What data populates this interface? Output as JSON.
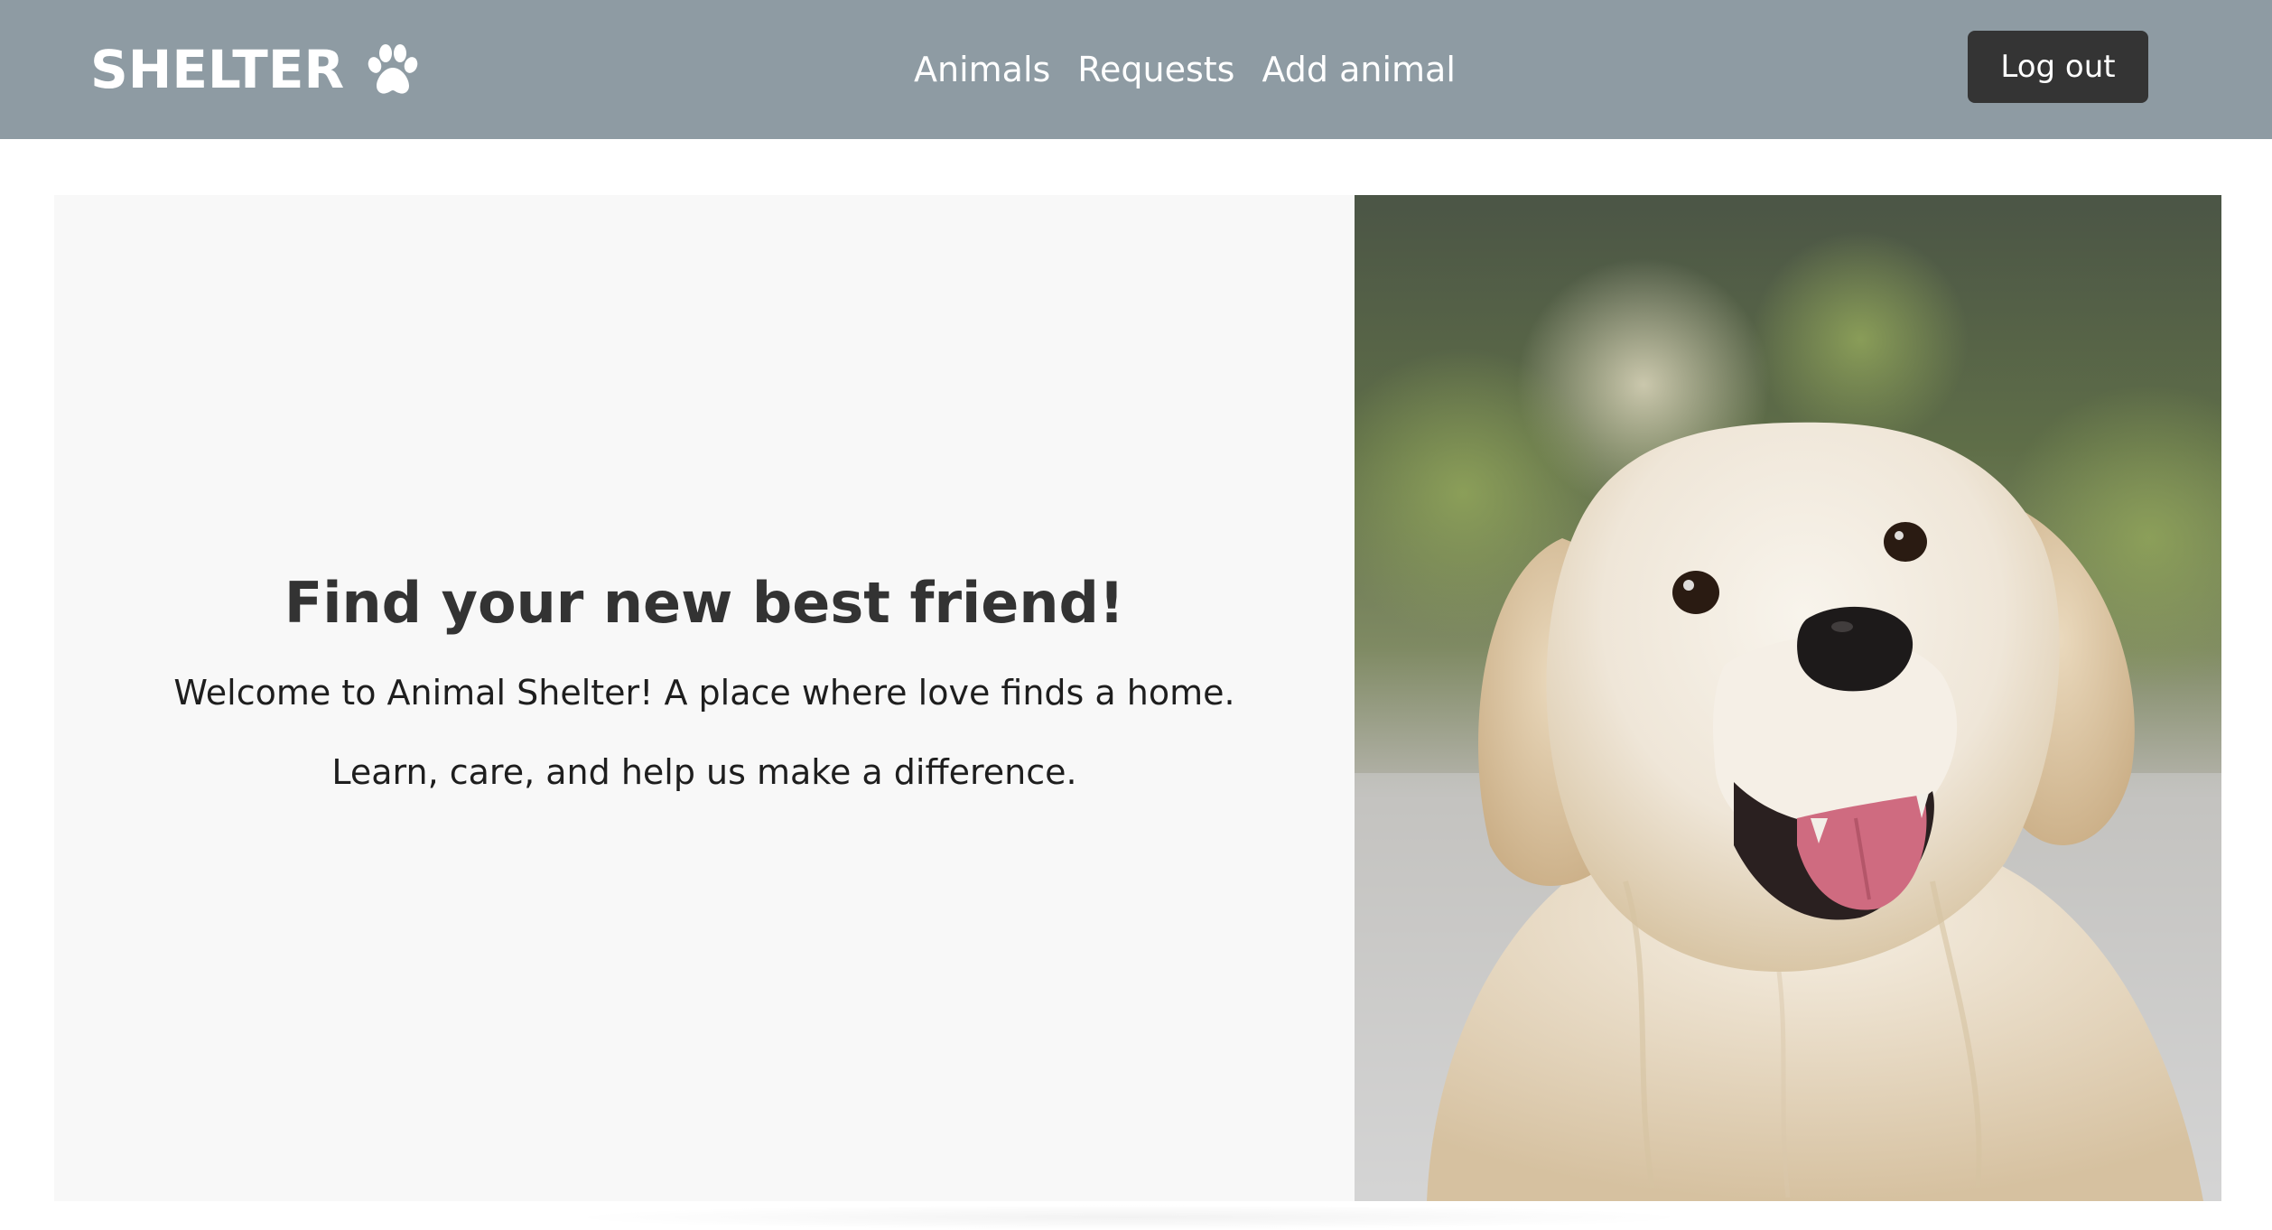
{
  "brand": {
    "name": "SHELTER",
    "icon": "paw-icon"
  },
  "nav": {
    "links": [
      {
        "label": "Animals"
      },
      {
        "label": "Requests"
      },
      {
        "label": "Add animal"
      }
    ]
  },
  "header": {
    "logout_label": "Log out"
  },
  "hero": {
    "title": "Find your new best friend!",
    "line1": "Welcome to Animal Shelter! A place where love finds a home.",
    "line2": "Learn, care, and help us make a difference."
  },
  "colors": {
    "header_bg": "#8e9ba3",
    "button_bg": "#343434",
    "hero_bg": "#f8f8f8",
    "text": "#333333"
  }
}
